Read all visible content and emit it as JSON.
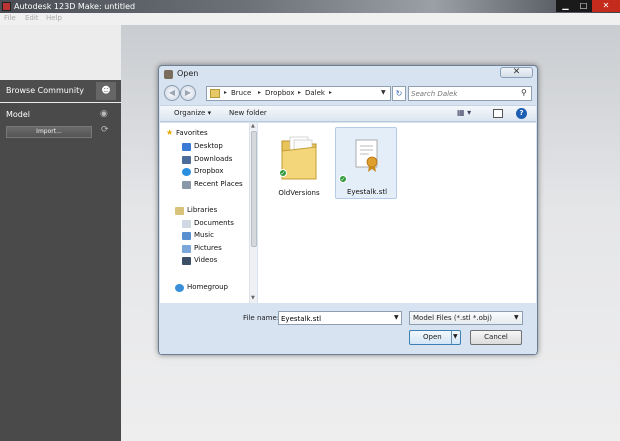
{
  "app": {
    "title": "Autodesk 123D Make: untitled",
    "window_controls": {
      "minimize": "▁",
      "maximize": "□",
      "close": "✕"
    }
  },
  "menubar": {
    "items": [
      "File",
      "Edit",
      "Help"
    ]
  },
  "left_panel": {
    "community_label": "Browse Community",
    "community_icon": "people-icon",
    "model_label": "Model",
    "visibility_icon": "eye-icon",
    "import_label": "Import...",
    "refresh_icon": "refresh-icon"
  },
  "dialog": {
    "title": "Open",
    "close_glyph": "✕",
    "breadcrumbs": [
      "Bruce",
      "Dropbox",
      "Dalek"
    ],
    "search_placeholder": "Search Dalek",
    "toolbar": {
      "organize": "Organize ▾",
      "new_folder": "New folder",
      "help": "?"
    },
    "nav": {
      "favorites_header": "Favorites",
      "favorites": [
        "Desktop",
        "Downloads",
        "Dropbox",
        "Recent Places"
      ],
      "libraries_header": "Libraries",
      "libraries": [
        "Documents",
        "Music",
        "Pictures",
        "Videos"
      ],
      "homegroup": "Homegroup"
    },
    "files": [
      {
        "name": "OldVersions",
        "type": "folder",
        "synced": true
      },
      {
        "name": "Eyestalk.stl",
        "type": "stl-file",
        "synced": true,
        "selected": true
      }
    ],
    "file_name_label": "File name:",
    "file_name_value": "Eyestalk.stl",
    "filter_value": "Model Files (*.stl *.obj)",
    "open_label": "Open",
    "cancel_label": "Cancel"
  },
  "colors": {
    "accent": "#1f5fb3",
    "panel_dark": "#4a4a4a",
    "dialog_bg": "#d7e3f1"
  }
}
